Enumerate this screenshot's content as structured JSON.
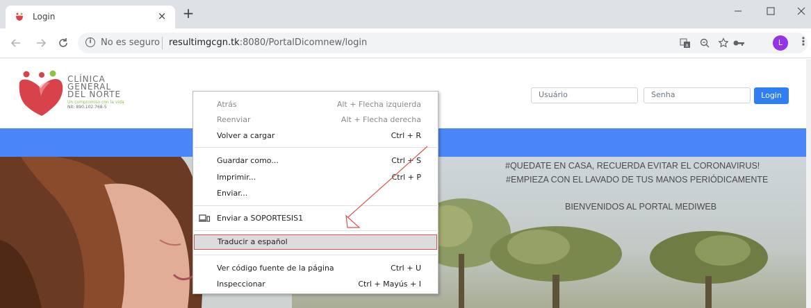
{
  "browser": {
    "tab_title": "Login",
    "tab_close": "×",
    "new_tab": "+",
    "window_min": "—",
    "window_max": "☐",
    "window_close": "✕",
    "security_label": "No es seguro",
    "url_host": "resultimgcgn.tk",
    "url_rest": ":8080/PortalDicomnew/login",
    "avatar_letter": "L",
    "icons": {
      "back": "arrow-left-icon",
      "forward": "arrow-right-icon",
      "reload": "reload-icon",
      "info": "info-icon",
      "translate": "translate-icon",
      "zoom": "zoom-icon",
      "star": "star-icon",
      "key": "key-icon",
      "menu": "kebab-menu-icon"
    }
  },
  "site": {
    "logo": {
      "line1": "CLÍNICA",
      "line2": "GENERAL",
      "line3": "DEL NORTE",
      "tagline": "Un compromiso con la vida",
      "nit": "Nit: 890.102.768-5"
    },
    "login": {
      "user_placeholder": "Usuário",
      "pass_placeholder": "Senha",
      "button": "Login"
    },
    "hero": {
      "line1": "#QUEDATE EN CASA, RECUERDA EVITAR EL CORONAVIRUS!",
      "line2": "#EMPIEZA CON EL LAVADO DE TUS MANOS PERIÓDICAMENTE",
      "welcome": "BIENVENIDOS AL PORTAL MEDIWEB"
    },
    "colors": {
      "nav_blue": "#4a86f7",
      "login_blue": "#2f7ef4",
      "logo_red": "#d8424a",
      "logo_green": "#8bc34a"
    }
  },
  "context_menu": {
    "items": [
      {
        "label": "Atrás",
        "accel": "Alt + Flecha izquierda",
        "disabled": true
      },
      {
        "label": "Reenviar",
        "accel": "Alt + Flecha derecha",
        "disabled": true
      },
      {
        "label": "Volver a cargar",
        "accel": "Ctrl + R"
      },
      {
        "label": "Guardar como...",
        "accel": "Ctrl + S"
      },
      {
        "label": "Imprimir...",
        "accel": "Ctrl + P"
      },
      {
        "label": "Enviar..."
      },
      {
        "label": "Enviar a SOPORTESIS1",
        "icon": "device-icon"
      },
      {
        "label": "Traducir a español",
        "highlighted": true
      },
      {
        "label": "Ver código fuente de la página",
        "accel": "Ctrl + U"
      },
      {
        "label": "Inspeccionar",
        "accel": "Ctrl + Mayús + I"
      }
    ],
    "annotation_color": "#d9534f"
  }
}
